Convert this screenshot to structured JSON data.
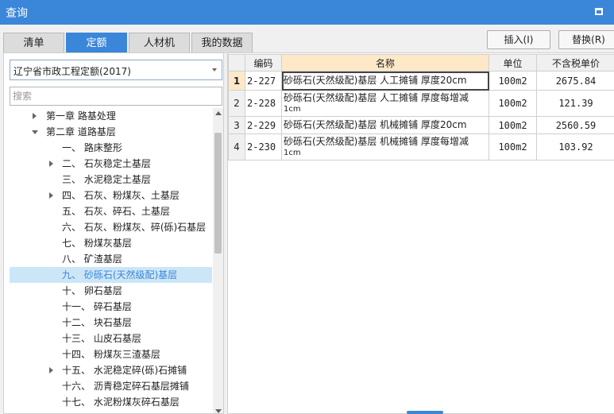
{
  "window": {
    "title": "查询"
  },
  "tabs": [
    {
      "label": "清单",
      "active": false
    },
    {
      "label": "定额",
      "active": true
    },
    {
      "label": "人材机",
      "active": false
    },
    {
      "label": "我的数据",
      "active": false
    }
  ],
  "toolbar": {
    "insert_label": "插入(I)",
    "replace_label": "替换(R)"
  },
  "left": {
    "library_select": "辽宁省市政工程定额(2017)",
    "search_placeholder": "搜索",
    "tree": [
      {
        "label": "第一章  路基处理",
        "arrow": "right",
        "level": 0
      },
      {
        "label": "第二章  道路基层",
        "arrow": "down",
        "level": 0
      },
      {
        "label": "一、  路床整形",
        "arrow": "",
        "level": 1
      },
      {
        "label": "二、  石灰稳定土基层",
        "arrow": "right",
        "level": 1
      },
      {
        "label": "三、  水泥稳定土基层",
        "arrow": "",
        "level": 1
      },
      {
        "label": "四、  石灰、粉煤灰、土基层",
        "arrow": "right",
        "level": 1
      },
      {
        "label": "五、  石灰、碎石、土基层",
        "arrow": "",
        "level": 1
      },
      {
        "label": "六、  石灰、粉煤灰、碎(砾)石基层",
        "arrow": "",
        "level": 1
      },
      {
        "label": "七、  粉煤灰基层",
        "arrow": "",
        "level": 1
      },
      {
        "label": "八、  矿渣基层",
        "arrow": "",
        "level": 1
      },
      {
        "label": "九、  砂砾石(天然级配)基层",
        "arrow": "",
        "level": 1,
        "selected": true
      },
      {
        "label": "十、  卵石基层",
        "arrow": "",
        "level": 1
      },
      {
        "label": "十一、  碎石基层",
        "arrow": "",
        "level": 1
      },
      {
        "label": "十二、  块石基层",
        "arrow": "",
        "level": 1
      },
      {
        "label": "十三、  山皮石基层",
        "arrow": "",
        "level": 1
      },
      {
        "label": "十四、  粉煤灰三渣基层",
        "arrow": "",
        "level": 1
      },
      {
        "label": "十五、  水泥稳定碎(砾)石摊铺",
        "arrow": "right",
        "level": 1
      },
      {
        "label": "十六、  沥青稳定碎石基层摊铺",
        "arrow": "",
        "level": 1
      },
      {
        "label": "十七、  水泥粉煤灰碎石基层",
        "arrow": "",
        "level": 1
      }
    ]
  },
  "table": {
    "columns": [
      "编码",
      "名称",
      "单位",
      "不含税单价"
    ],
    "rows": [
      {
        "index": "1",
        "code": "2-227",
        "name": "砂砾石(天然级配)基层 人工摊铺 厚度20cm",
        "name2": "",
        "unit": "100m2",
        "price": "2675.84"
      },
      {
        "index": "2",
        "code": "2-228",
        "name": "砂砾石(天然级配)基层 人工摊铺 厚度每增减",
        "name2": "1cm",
        "unit": "100m2",
        "price": "121.39"
      },
      {
        "index": "3",
        "code": "2-229",
        "name": "砂砾石(天然级配)基层 机械摊铺 厚度20cm",
        "name2": "",
        "unit": "100m2",
        "price": "2560.59"
      },
      {
        "index": "4",
        "code": "2-230",
        "name": "砂砾石(天然级配)基层 机械摊铺 厚度每增减",
        "name2": "1cm",
        "unit": "100m2",
        "price": "103.92"
      }
    ]
  },
  "colors": {
    "accent": "#3a86d9",
    "header_highlight": "#fde8c8",
    "selected_bg": "#cde6f7"
  }
}
